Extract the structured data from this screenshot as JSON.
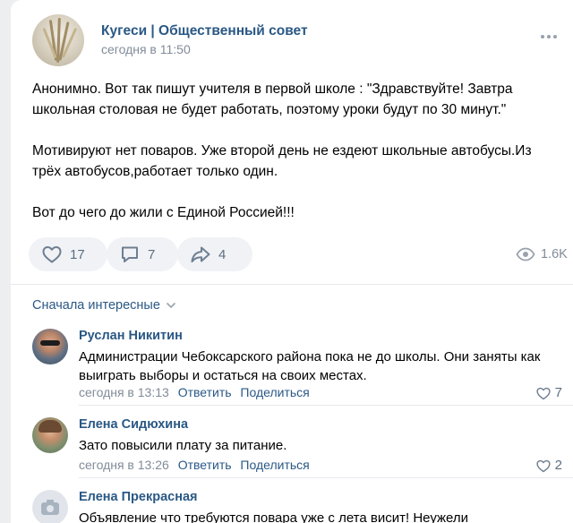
{
  "post": {
    "group_name": "Кугеси | Общественный совет",
    "time": "сегодня в 11:50",
    "paragraphs": [
      "Анонимно. Вот так пишут учителя в первой школе : \"Здравствуйте! Завтра школьная столовая не будет работать, поэтому уроки будут по 30 минут.\"",
      "Мотивируют нет поваров. Уже второй день не ездеют школьные автобусы.Из трёх автобусов,работает только один.",
      "Вот до чего до жили с Единой Россией!!!"
    ],
    "likes": "17",
    "comments": "7",
    "shares": "4",
    "views": "1.6K",
    "icons": {
      "more": "more-horizontal-icon",
      "like": "heart-icon",
      "comment": "comment-icon",
      "share": "share-arrow-icon",
      "views": "eye-icon"
    }
  },
  "comments_section": {
    "sort_label": "Сначала интересные",
    "items": [
      {
        "name": "Руслан Никитин",
        "text": "Администрации Чебоксарского района пока не до школы. Они заняты как выиграть выборы и остаться на своих местах.",
        "time": "сегодня в 13:13",
        "reply": "Ответить",
        "share": "Поделиться",
        "likes": "7"
      },
      {
        "name": "Елена Сидюхина",
        "text": "Зато повысили плату за питание.",
        "time": "сегодня в 13:26",
        "reply": "Ответить",
        "share": "Поделиться",
        "likes": "2"
      },
      {
        "name": "Елена Прекрасная",
        "text": "Объявление что требуются повара уже с лета висит! Неужели"
      }
    ]
  },
  "colors": {
    "link": "#2a5885",
    "muted": "#818c99",
    "button_bg": "#f0f2f5",
    "page_bg": "#edeef0"
  }
}
